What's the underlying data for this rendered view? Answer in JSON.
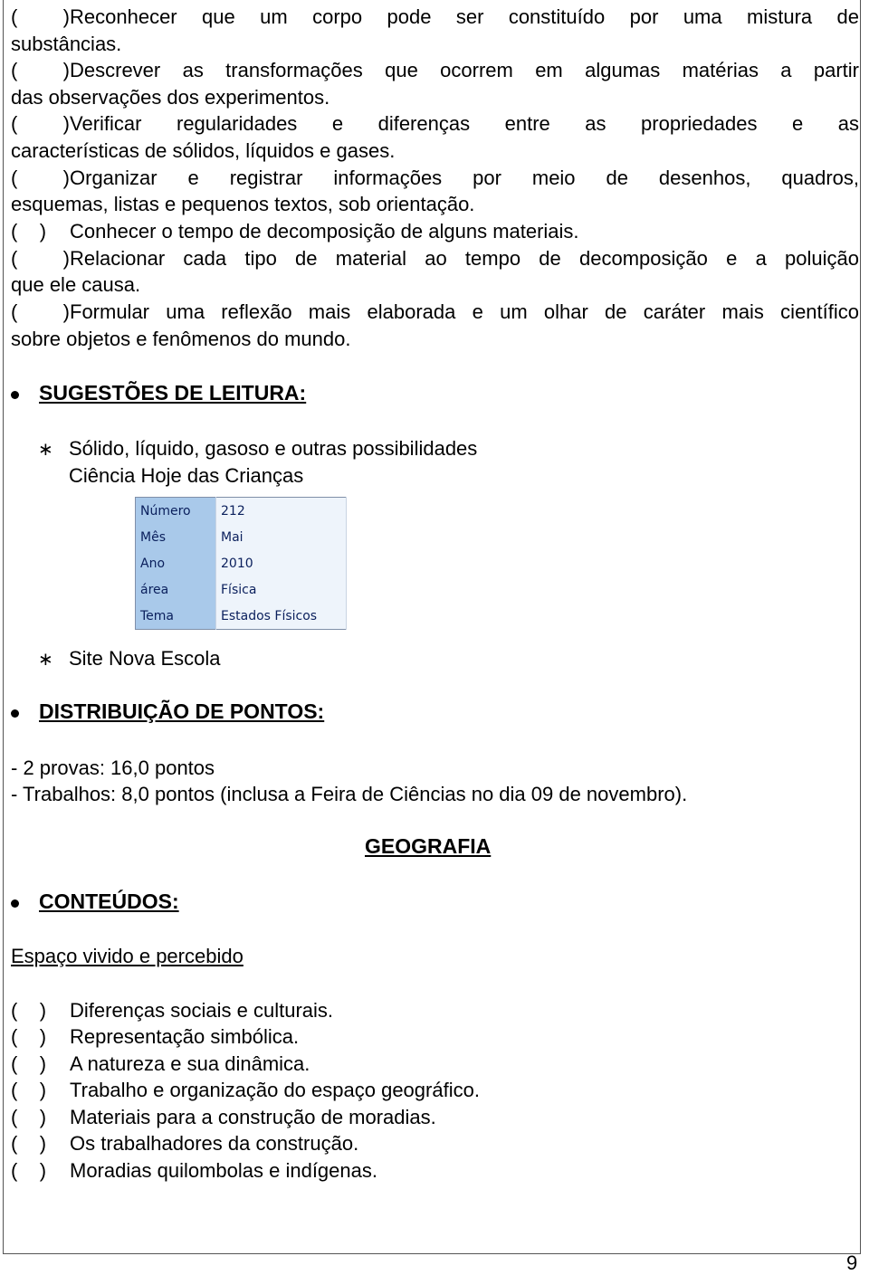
{
  "objectives_continued": [
    {
      "paren": "(    )",
      "text": "Reconhecer que um corpo pode ser constituído por uma mistura de",
      "cont": "substâncias."
    },
    {
      "paren": "(    )",
      "text": "Descrever as transformações que ocorrem em algumas matérias a partir",
      "cont": "das observações dos experimentos."
    },
    {
      "paren": "(    )",
      "text": "Verificar regularidades e diferenças entre as propriedades e as",
      "cont": "características de sólidos, líquidos e gases."
    },
    {
      "paren": "(    )",
      "text": "Organizar e registrar informações por meio de desenhos, quadros,",
      "cont": "esquemas, listas e pequenos textos, sob orientação."
    },
    {
      "paren": "(    )",
      "text": "Conhecer o tempo de decomposição de alguns materiais.",
      "cont": ""
    },
    {
      "paren": "(    )",
      "text": "Relacionar cada tipo de material ao tempo de decomposição e a poluição",
      "cont": "que ele causa."
    },
    {
      "paren": "(    )",
      "text": "Formular uma reflexão mais elaborada e um olhar de caráter mais científico",
      "cont": "sobre objetos e fenômenos do mundo."
    }
  ],
  "reading": {
    "heading": "SUGESTÕES DE LEITURA:",
    "item1_title": "Sólido, líquido, gasoso e outras possibilidades",
    "item1_source": "Ciência Hoje das Crianças",
    "table": [
      {
        "key": "Número",
        "value": "212"
      },
      {
        "key": "Mês",
        "value": "Mai"
      },
      {
        "key": "Ano",
        "value": "2010"
      },
      {
        "key": "área",
        "value": "Física"
      },
      {
        "key": "Tema",
        "value": "Estados Físicos"
      }
    ],
    "item2_title": "Site Nova Escola"
  },
  "points": {
    "heading": "DISTRIBUIÇÃO DE PONTOS:",
    "line1": "- 2 provas: 16,0 pontos",
    "line2": "- Trabalhos: 8,0 pontos (inclusa a Feira de Ciências no dia 09 de novembro)."
  },
  "geografia": {
    "title": "GEOGRAFIA",
    "contents_heading": "CONTEÚDOS:",
    "subheading": "Espaço vivido e percebido",
    "items": [
      {
        "paren": "(    )",
        "text": "Diferenças sociais e culturais."
      },
      {
        "paren": "(    )",
        "text": "Representação simbólica."
      },
      {
        "paren": "(    )",
        "text": "A natureza e sua dinâmica."
      },
      {
        "paren": "(    )",
        "text": "Trabalho e organização do espaço geográfico."
      },
      {
        "paren": "(    )",
        "text": "Materiais para a construção de moradias."
      },
      {
        "paren": "(    )",
        "text": "Os trabalhadores da construção."
      },
      {
        "paren": "(    )",
        "text": "Moradias quilombolas e indígenas."
      }
    ]
  },
  "page_number": "9"
}
